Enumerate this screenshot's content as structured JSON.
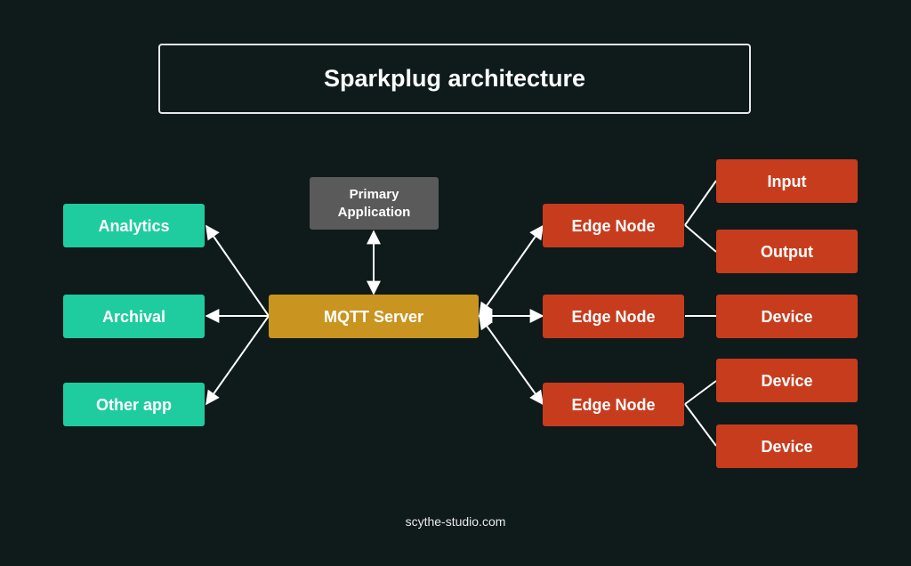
{
  "title": "Sparkplug architecture",
  "footer": "scythe-studio.com",
  "colors": {
    "background": "#0f1a1a",
    "application": "#1fcc9f",
    "server": "#c99520",
    "primary": "#5a5a5a",
    "edge": "#c83c1e"
  },
  "nodes": {
    "analytics": "Analytics",
    "archival": "Archival",
    "other_app": "Other app",
    "primary_line1": "Primary",
    "primary_line2": "Application",
    "mqtt": "MQTT Server",
    "edge1": "Edge Node",
    "edge2": "Edge Node",
    "edge3": "Edge Node",
    "input": "Input",
    "output": "Output",
    "device1": "Device",
    "device2": "Device",
    "device3": "Device"
  },
  "connections": [
    {
      "from": "MQTT Server",
      "to": "Analytics",
      "arrow": "to"
    },
    {
      "from": "MQTT Server",
      "to": "Archival",
      "arrow": "to"
    },
    {
      "from": "MQTT Server",
      "to": "Other app",
      "arrow": "to"
    },
    {
      "from": "MQTT Server",
      "to": "Primary Application",
      "arrow": "both"
    },
    {
      "from": "MQTT Server",
      "to": "Edge Node 1",
      "arrow": "both"
    },
    {
      "from": "MQTT Server",
      "to": "Edge Node 2",
      "arrow": "both"
    },
    {
      "from": "MQTT Server",
      "to": "Edge Node 3",
      "arrow": "both"
    },
    {
      "from": "Edge Node 1",
      "to": "Input",
      "arrow": "none"
    },
    {
      "from": "Edge Node 1",
      "to": "Output",
      "arrow": "none"
    },
    {
      "from": "Edge Node 2",
      "to": "Device",
      "arrow": "none"
    },
    {
      "from": "Edge Node 3",
      "to": "Device",
      "arrow": "none"
    },
    {
      "from": "Edge Node 3",
      "to": "Device",
      "arrow": "none"
    }
  ]
}
